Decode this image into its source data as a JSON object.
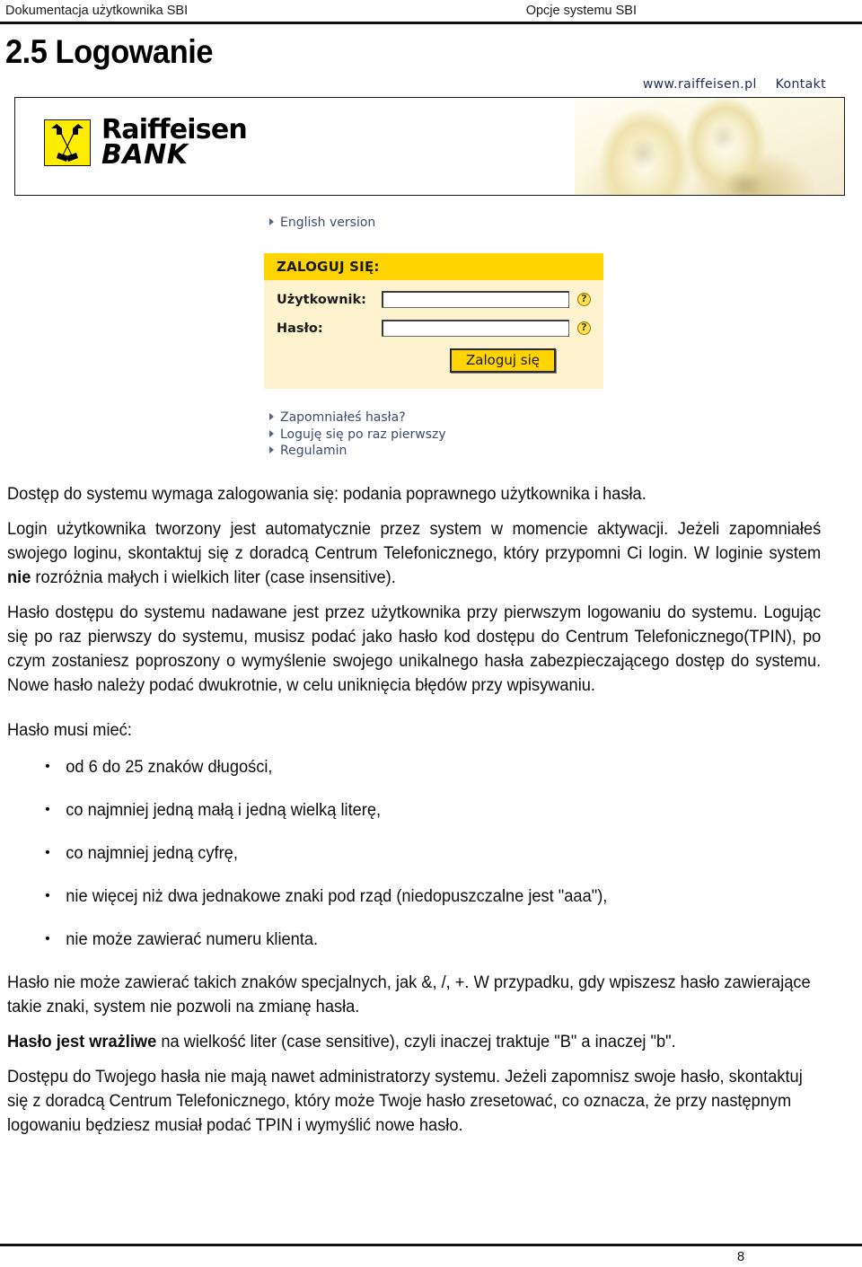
{
  "header": {
    "left": "Dokumentacja użytkownika SBI",
    "right": "Opcje systemu SBI"
  },
  "heading": "2.5 Logowanie",
  "screenshot": {
    "top_links": {
      "site": "www.raiffeisen.pl",
      "contact": "Kontakt"
    },
    "logo": {
      "line1": "Raiffeisen",
      "line2": "BANK",
      "mark_color": "#ffed00"
    },
    "english_link": "English version",
    "login_box": {
      "title": "ZALOGUJ SIĘ:",
      "user_label": "Użytkownik:",
      "user_value": "",
      "user_placeholder": "",
      "password_label": "Hasło:",
      "password_value": "",
      "password_placeholder": "",
      "help_glyph": "?",
      "submit_label": "Zaloguj się",
      "title_bg": "#ffd400",
      "body_bg": "#fdf3cf"
    },
    "links": [
      "Zapomniałeś hasła?",
      "Loguję się po raz pierwszy",
      "Regulamin"
    ]
  },
  "content": {
    "p1": "Dostęp do systemu wymaga zalogowania się: podania poprawnego użytkownika i hasła.",
    "p2_a": "Login użytkownika tworzony jest automatycznie przez system w momencie aktywacji. Jeżeli zapomniałeś swojego loginu, skontaktuj się z doradcą Centrum Telefonicznego, który przypomni Ci login. W loginie system ",
    "p2_bold": "nie",
    "p2_b": " rozróżnia małych i wielkich liter (case insensitive).",
    "p3": "Hasło dostępu do systemu nadawane jest przez użytkownika przy pierwszym logowaniu do systemu. Logując się po raz pierwszy do systemu, musisz podać jako hasło kod dostępu do Centrum Telefonicznego(TPIN), po czym zostaniesz poproszony o wymyślenie swojego unikalnego hasła zabezpieczającego dostęp do systemu. Nowe hasło należy podać dwukrotnie, w celu uniknięcia błędów przy wpisywaniu.",
    "p4": "Hasło musi mieć:",
    "bullets": [
      "od 6 do 25 znaków długości,",
      "co najmniej jedną małą i jedną wielką literę,",
      "co najmniej jedną cyfrę,",
      "nie więcej niż dwa jednakowe znaki pod rząd (niedopuszczalne jest \"aaa\"),",
      "nie może zawierać numeru klienta."
    ],
    "p5": "Hasło nie może zawierać takich znaków specjalnych, jak &, /, +. W przypadku, gdy wpiszesz hasło zawierające takie znaki, system nie pozwoli na zmianę hasła.",
    "p6_bold": "Hasło jest wrażliwe",
    "p6_rest": " na wielkość liter (case sensitive), czyli inaczej traktuje \"B\" a inaczej \"b\".",
    "p7": "Dostępu do Twojego hasła nie mają nawet administratorzy systemu. Jeżeli zapomnisz swoje hasło, skontaktuj się z doradcą Centrum Telefonicznego, który może Twoje hasło zresetować, co oznacza, że przy następnym logowaniu będziesz musiał podać TPIN i wymyślić nowe hasło."
  },
  "footer": {
    "page_number": "8"
  }
}
